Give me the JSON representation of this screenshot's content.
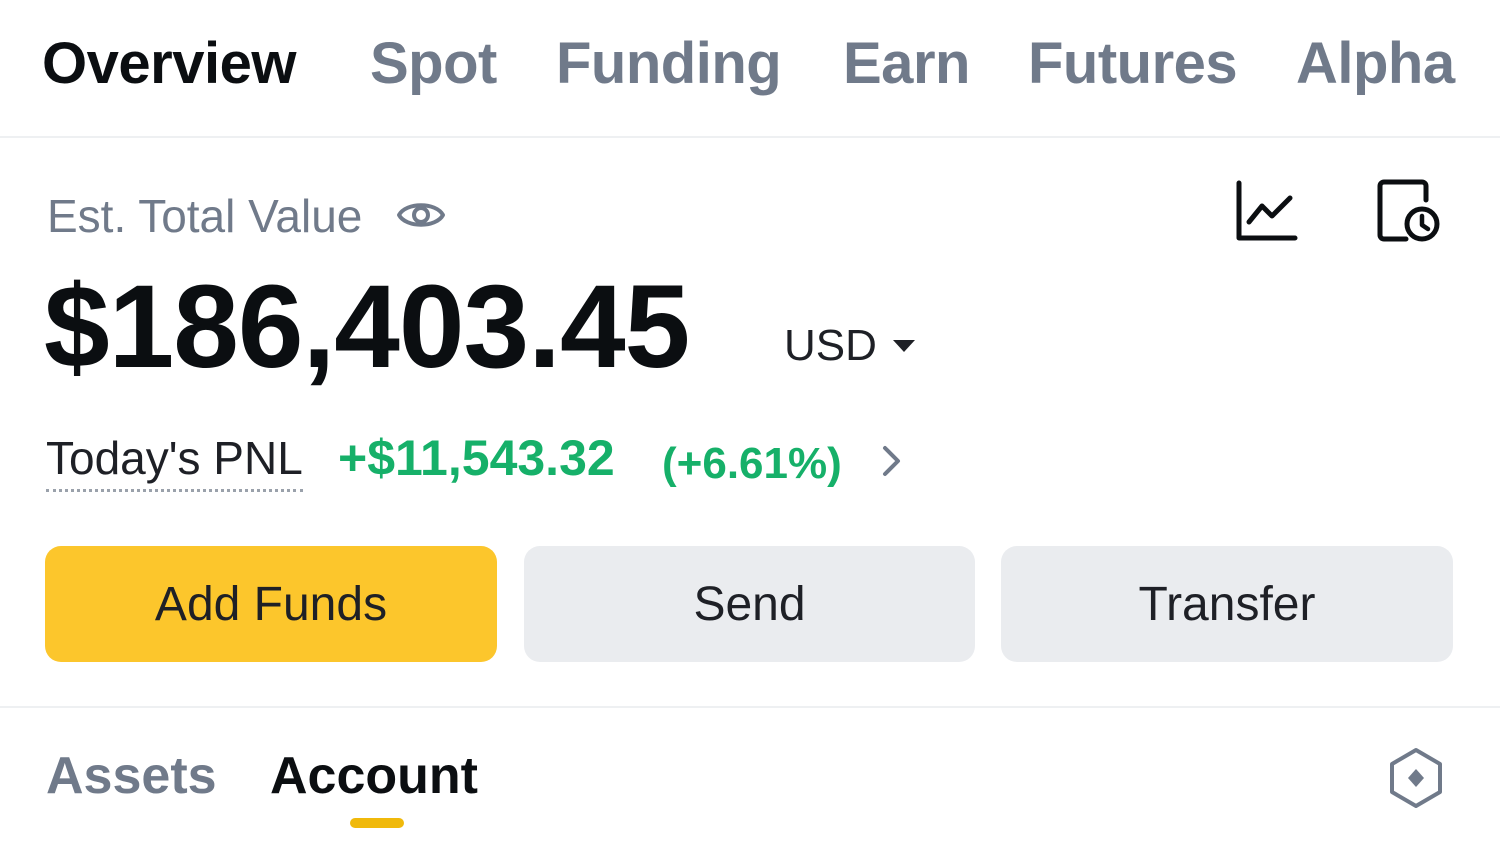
{
  "top_tabs": [
    {
      "label": "Overview",
      "active": true
    },
    {
      "label": "Spot",
      "active": false
    },
    {
      "label": "Funding",
      "active": false
    },
    {
      "label": "Earn",
      "active": false
    },
    {
      "label": "Futures",
      "active": false
    },
    {
      "label": "Alpha",
      "active": false
    }
  ],
  "summary": {
    "label": "Est. Total Value",
    "balance": "$186,403.45",
    "currency": "USD",
    "pnl_label": "Today's PNL",
    "pnl_value": "+$11,543.32",
    "pnl_percent": "(+6.61%)"
  },
  "icons": {
    "visibility": "eye-icon",
    "chart": "line-chart-icon",
    "history": "document-clock-icon",
    "currency_dropdown": "caret-down-icon",
    "pnl_detail": "chevron-right-icon",
    "settings": "hexagon-settings-icon"
  },
  "actions": {
    "add_funds": "Add Funds",
    "send": "Send",
    "transfer": "Transfer"
  },
  "sub_tabs": [
    {
      "label": "Assets",
      "active": false
    },
    {
      "label": "Account",
      "active": true
    }
  ],
  "colors": {
    "accent_yellow": "#FCC62C",
    "underline_yellow": "#F0B90B",
    "positive_green": "#16B069",
    "secondary_button": "#EAECEF",
    "muted_text": "#707A8A"
  }
}
